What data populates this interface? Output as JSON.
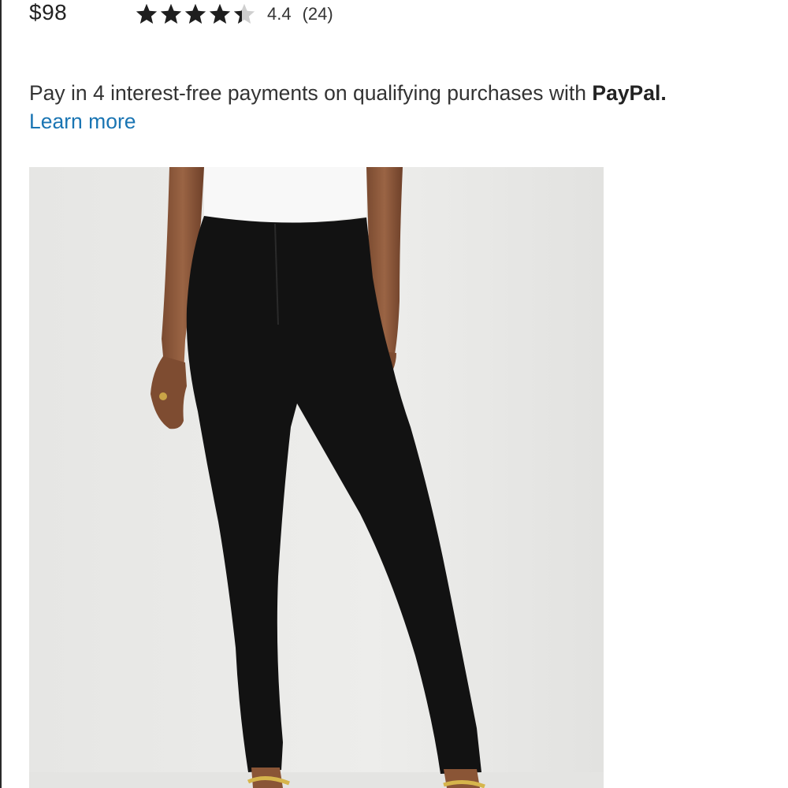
{
  "product": {
    "price": "$98",
    "rating": {
      "value": "4.4",
      "count": "(24)",
      "stars_filled": 4.4,
      "stars_total": 5,
      "star_color": "#1f1f1f",
      "star_empty_color": "#cfcfcf"
    }
  },
  "paypal": {
    "message": "Pay in 4 interest-free payments on qualifying purchases with ",
    "brand": "PayPal.",
    "link_label": "Learn more",
    "link_color": "#1a75b3"
  },
  "image": {
    "subject": "model-wearing-black-skinny-pants",
    "background_color": "#ebebe9"
  }
}
